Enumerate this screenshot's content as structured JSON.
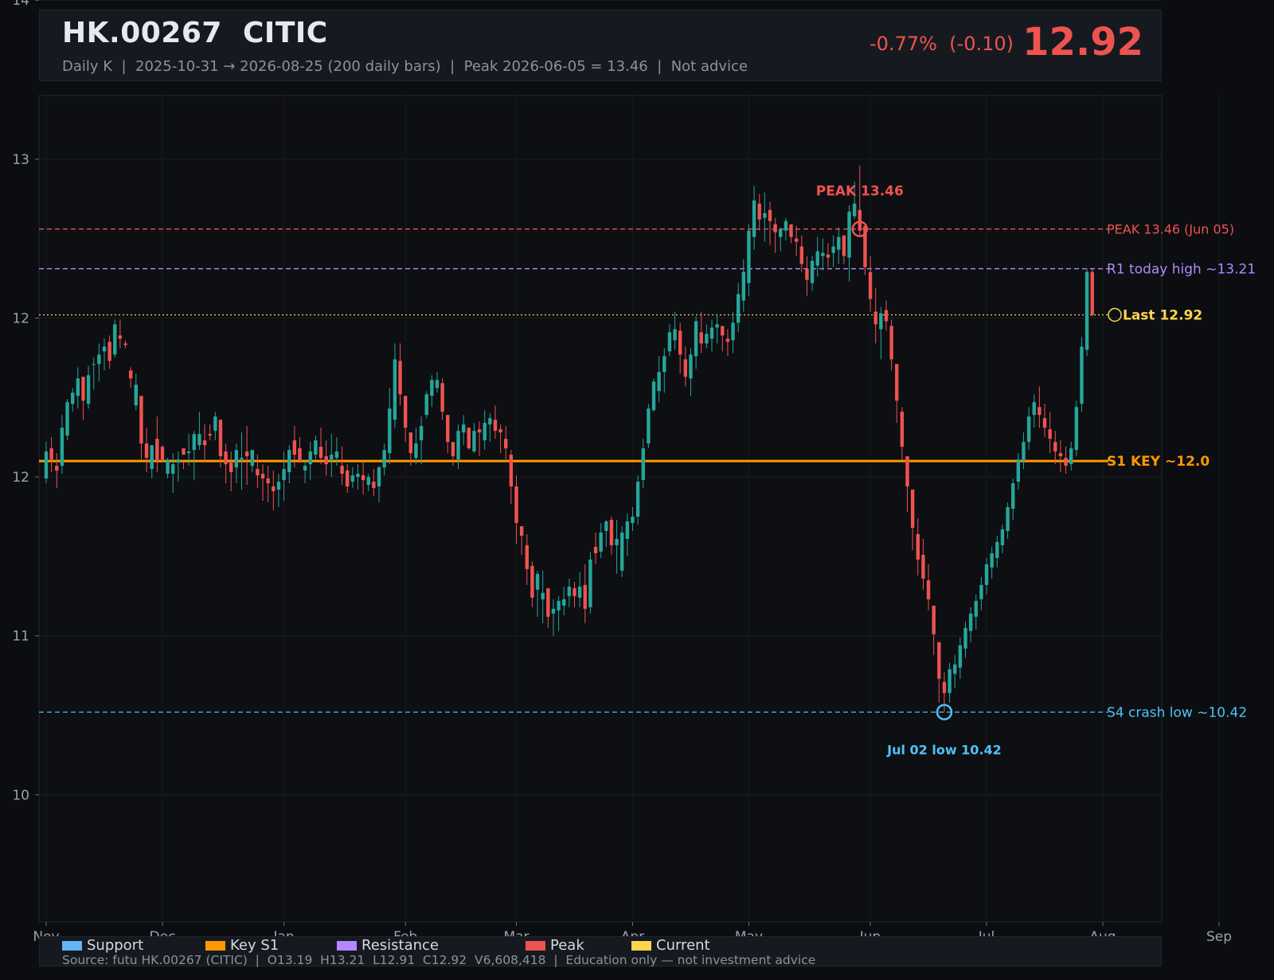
{
  "header": {
    "ticker": "HK.00267  CITIC",
    "subtitle": "Daily K  |  2025-10-31 → 2026-08-25 (200 daily bars)  |  Peak 2026-06-05 = 13.46  |  Not advice",
    "change": "-0.77%  (-0.10)",
    "price": "12.92"
  },
  "chart_data": {
    "type": "candlestick",
    "y_ticks": [
      "10",
      "11",
      "12",
      "12",
      "13",
      "14"
    ],
    "y_tick_values": [
      9.9,
      10.9,
      11.9,
      12.9,
      13.9,
      14.9
    ],
    "x_ticks": [
      "Nov",
      "Dec",
      "Jan",
      "Feb",
      "Mar",
      "Apr",
      "May",
      "Jun",
      "Jul",
      "Aug",
      "Sep"
    ],
    "x_tick_bars": [
      0,
      22,
      45,
      68,
      89,
      111,
      133,
      156,
      178,
      200,
      222
    ],
    "ylim": [
      9.1,
      14.3
    ],
    "grid": true,
    "levels": [
      {
        "name": "PEAK 13.46 (Jun 05)",
        "value": 13.46,
        "kind": "peak",
        "color": "#ef5350",
        "style": "dashed"
      },
      {
        "name": "R1 today high ~13.21",
        "value": 13.21,
        "kind": "resistance",
        "color": "#b388ff",
        "style": "dashed"
      },
      {
        "name": "Last 12.92",
        "value": 12.92,
        "kind": "current",
        "color": "#ffd54f",
        "style": "dotted"
      },
      {
        "name": "S1 KEY ~12.0",
        "value": 12.0,
        "kind": "key",
        "color": "#ff9800",
        "style": "solid"
      },
      {
        "name": "S4 crash low ~10.42",
        "value": 10.42,
        "kind": "support",
        "color": "#4fc3f7",
        "style": "dashed"
      }
    ],
    "annotations": [
      {
        "text": "PEAK 13.46",
        "value": 13.46,
        "color": "#ef5350"
      },
      {
        "text": "Jul 02 low 10.42",
        "value": 10.42,
        "color": "#4fc3f7"
      }
    ],
    "ohlc": [
      [
        11.89,
        12.12,
        11.86,
        12.06
      ],
      [
        12.08,
        12.15,
        11.93,
        12.01
      ],
      [
        11.97,
        12.05,
        11.83,
        11.94
      ],
      [
        11.97,
        12.29,
        11.92,
        12.21
      ],
      [
        12.16,
        12.39,
        12.13,
        12.37
      ],
      [
        12.36,
        12.46,
        12.31,
        12.43
      ],
      [
        12.41,
        12.59,
        12.33,
        12.52
      ],
      [
        12.53,
        12.52,
        12.26,
        12.38
      ],
      [
        12.36,
        12.6,
        12.33,
        12.54
      ],
      [
        12.61,
        12.65,
        12.45,
        12.61
      ],
      [
        12.61,
        12.74,
        12.5,
        12.67
      ],
      [
        12.69,
        12.77,
        12.57,
        12.72
      ],
      [
        12.75,
        12.79,
        12.58,
        12.63
      ],
      [
        12.67,
        12.89,
        12.65,
        12.86
      ],
      [
        12.79,
        12.89,
        12.71,
        12.77
      ],
      [
        12.74,
        12.76,
        12.71,
        12.73
      ],
      [
        12.57,
        12.59,
        12.46,
        12.52
      ],
      [
        12.35,
        12.55,
        12.32,
        12.48
      ],
      [
        12.41,
        12.29,
        12.01,
        12.11
      ],
      [
        12.11,
        12.21,
        11.93,
        12.02
      ],
      [
        11.95,
        12.09,
        11.89,
        12.1
      ],
      [
        12.14,
        12.28,
        11.93,
        12.0
      ],
      [
        12.09,
        12.1,
        11.99,
        12.01
      ],
      [
        11.92,
        12.02,
        11.89,
        12.01
      ],
      [
        11.92,
        12.05,
        11.8,
        11.98
      ],
      [
        11.99,
        12.06,
        11.87,
        12.01
      ],
      [
        12.08,
        12.0,
        11.95,
        12.04
      ],
      [
        12.05,
        12.17,
        11.97,
        12.06
      ],
      [
        12.07,
        12.19,
        11.88,
        12.17
      ],
      [
        12.1,
        12.31,
        12.07,
        12.17
      ],
      [
        12.13,
        12.23,
        11.99,
        12.1
      ],
      [
        12.17,
        12.23,
        12.13,
        12.16
      ],
      [
        12.19,
        12.31,
        12.13,
        12.28
      ],
      [
        12.26,
        12.15,
        11.96,
        12.03
      ],
      [
        12.06,
        12.11,
        11.86,
        11.98
      ],
      [
        11.99,
        12.06,
        11.81,
        11.93
      ],
      [
        11.96,
        12.11,
        11.86,
        12.07
      ],
      [
        12.01,
        12.18,
        11.82,
        12.02
      ],
      [
        12.06,
        12.22,
        11.85,
        12.03
      ],
      [
        11.97,
        12.03,
        11.93,
        12.07
      ],
      [
        11.95,
        12.04,
        11.83,
        11.91
      ],
      [
        11.92,
        11.98,
        11.75,
        11.89
      ],
      [
        11.89,
        11.97,
        11.74,
        11.86
      ],
      [
        11.84,
        11.94,
        11.69,
        11.81
      ],
      [
        11.82,
        11.92,
        11.71,
        11.87
      ],
      [
        11.88,
        12.06,
        11.75,
        11.95
      ],
      [
        11.93,
        12.1,
        11.86,
        12.07
      ],
      [
        12.13,
        12.22,
        11.96,
        12.04
      ],
      [
        12.08,
        12.15,
        11.99,
        12.0
      ],
      [
        11.94,
        12.0,
        11.86,
        11.97
      ],
      [
        11.98,
        12.12,
        11.88,
        12.06
      ],
      [
        12.04,
        12.16,
        12.01,
        12.13
      ],
      [
        12.09,
        12.21,
        11.98,
        12.02
      ],
      [
        12.03,
        12.13,
        11.91,
        11.98
      ],
      [
        12.01,
        12.17,
        11.9,
        12.04
      ],
      [
        12.02,
        12.15,
        11.97,
        12.06
      ],
      [
        11.97,
        12.09,
        11.85,
        11.92
      ],
      [
        11.94,
        11.98,
        11.8,
        11.84
      ],
      [
        11.87,
        11.96,
        11.83,
        11.91
      ],
      [
        11.9,
        11.98,
        11.82,
        11.92
      ],
      [
        11.91,
        12.0,
        11.79,
        11.88
      ],
      [
        11.85,
        11.92,
        11.81,
        11.9
      ],
      [
        11.87,
        11.95,
        11.78,
        11.83
      ],
      [
        11.84,
        11.97,
        11.74,
        11.96
      ],
      [
        11.96,
        12.11,
        11.91,
        12.07
      ],
      [
        12.05,
        12.46,
        11.98,
        12.33
      ],
      [
        12.26,
        12.74,
        12.21,
        12.64
      ],
      [
        12.63,
        12.74,
        12.35,
        12.42
      ],
      [
        12.41,
        12.34,
        12.12,
        12.21
      ],
      [
        12.18,
        12.11,
        11.97,
        12.05
      ],
      [
        12.02,
        12.21,
        11.98,
        12.11
      ],
      [
        12.13,
        12.28,
        11.98,
        12.22
      ],
      [
        12.29,
        12.44,
        12.27,
        12.42
      ],
      [
        12.41,
        12.54,
        12.34,
        12.51
      ],
      [
        12.46,
        12.56,
        12.43,
        12.51
      ],
      [
        12.49,
        12.52,
        12.26,
        12.31
      ],
      [
        12.29,
        12.28,
        12.05,
        12.12
      ],
      [
        12.12,
        12.09,
        11.97,
        12.03
      ],
      [
        12.01,
        12.23,
        11.95,
        12.19
      ],
      [
        12.18,
        12.29,
        12.1,
        12.23
      ],
      [
        12.21,
        12.16,
        12.07,
        12.08
      ],
      [
        12.06,
        12.24,
        12.05,
        12.19
      ],
      [
        12.2,
        12.25,
        12.03,
        12.18
      ],
      [
        12.13,
        12.32,
        12.07,
        12.24
      ],
      [
        12.23,
        12.3,
        12.12,
        12.27
      ],
      [
        12.26,
        12.35,
        12.14,
        12.19
      ],
      [
        12.2,
        12.23,
        12.05,
        12.18
      ],
      [
        12.14,
        12.22,
        12.01,
        12.08
      ],
      [
        12.04,
        12.07,
        11.73,
        11.84
      ],
      [
        11.84,
        11.91,
        11.48,
        11.61
      ],
      [
        11.59,
        11.58,
        11.41,
        11.53
      ],
      [
        11.47,
        11.54,
        11.22,
        11.32
      ],
      [
        11.34,
        11.37,
        11.08,
        11.14
      ],
      [
        11.19,
        11.31,
        11.02,
        11.29
      ],
      [
        11.13,
        11.31,
        10.98,
        11.17
      ],
      [
        11.2,
        11.13,
        10.95,
        11.02
      ],
      [
        11.04,
        11.13,
        10.9,
        11.07
      ],
      [
        11.06,
        11.15,
        10.93,
        11.12
      ],
      [
        11.09,
        11.21,
        11.03,
        11.13
      ],
      [
        11.15,
        11.26,
        11.08,
        11.21
      ],
      [
        11.2,
        11.24,
        11.08,
        11.15
      ],
      [
        11.14,
        11.3,
        11.08,
        11.21
      ],
      [
        11.22,
        11.35,
        10.98,
        11.07
      ],
      [
        11.08,
        11.43,
        11.04,
        11.38
      ],
      [
        11.46,
        11.55,
        11.35,
        11.42
      ],
      [
        11.43,
        11.61,
        11.39,
        11.55
      ],
      [
        11.56,
        11.63,
        11.46,
        11.62
      ],
      [
        11.63,
        11.65,
        11.41,
        11.47
      ],
      [
        11.47,
        11.63,
        11.29,
        11.51
      ],
      [
        11.31,
        11.59,
        11.27,
        11.55
      ],
      [
        11.51,
        11.67,
        11.4,
        11.62
      ],
      [
        11.61,
        11.71,
        11.56,
        11.65
      ],
      [
        11.65,
        11.91,
        11.6,
        11.87
      ],
      [
        11.88,
        12.14,
        11.83,
        12.08
      ],
      [
        12.11,
        12.36,
        12.08,
        12.33
      ],
      [
        12.32,
        12.52,
        12.31,
        12.5
      ],
      [
        12.44,
        12.66,
        12.37,
        12.56
      ],
      [
        12.56,
        12.71,
        12.43,
        12.66
      ],
      [
        12.69,
        12.86,
        12.66,
        12.81
      ],
      [
        12.76,
        12.94,
        12.7,
        12.83
      ],
      [
        12.82,
        12.87,
        12.55,
        12.67
      ],
      [
        12.64,
        12.72,
        12.47,
        12.53
      ],
      [
        12.52,
        12.71,
        12.41,
        12.67
      ],
      [
        12.66,
        12.91,
        12.58,
        12.88
      ],
      [
        12.81,
        12.94,
        12.68,
        12.74
      ],
      [
        12.74,
        12.86,
        12.71,
        12.8
      ],
      [
        12.77,
        12.89,
        12.69,
        12.84
      ],
      [
        12.84,
        12.92,
        12.74,
        12.86
      ],
      [
        12.85,
        12.82,
        12.69,
        12.79
      ],
      [
        12.77,
        12.83,
        12.66,
        12.75
      ],
      [
        12.76,
        12.94,
        12.68,
        12.87
      ],
      [
        12.87,
        13.12,
        12.81,
        13.05
      ],
      [
        13.01,
        13.27,
        12.94,
        13.19
      ],
      [
        13.12,
        13.49,
        13.04,
        13.45
      ],
      [
        13.41,
        13.73,
        13.33,
        13.64
      ],
      [
        13.62,
        13.68,
        13.45,
        13.52
      ],
      [
        13.53,
        13.69,
        13.38,
        13.56
      ],
      [
        13.58,
        13.63,
        13.36,
        13.51
      ],
      [
        13.49,
        13.53,
        13.31,
        13.44
      ],
      [
        13.41,
        13.47,
        13.32,
        13.46
      ],
      [
        13.45,
        13.53,
        13.39,
        13.51
      ],
      [
        13.49,
        13.46,
        13.37,
        13.41
      ],
      [
        13.4,
        13.48,
        13.29,
        13.38
      ],
      [
        13.35,
        13.42,
        13.19,
        13.24
      ],
      [
        13.21,
        13.29,
        13.04,
        13.14
      ],
      [
        13.12,
        13.29,
        13.07,
        13.26
      ],
      [
        13.23,
        13.41,
        13.16,
        13.32
      ],
      [
        13.29,
        13.4,
        13.2,
        13.31
      ],
      [
        13.3,
        13.37,
        13.22,
        13.28
      ],
      [
        13.31,
        13.42,
        13.22,
        13.35
      ],
      [
        13.33,
        13.47,
        13.24,
        13.41
      ],
      [
        13.42,
        13.38,
        13.24,
        13.29
      ],
      [
        13.28,
        13.61,
        13.13,
        13.57
      ],
      [
        13.54,
        13.76,
        13.52,
        13.62
      ],
      [
        13.58,
        13.86,
        13.41,
        13.45
      ],
      [
        13.48,
        13.37,
        13.17,
        13.22
      ],
      [
        13.19,
        13.29,
        12.94,
        13.02
      ],
      [
        12.94,
        13.09,
        12.74,
        12.86
      ],
      [
        12.83,
        12.97,
        12.64,
        12.93
      ],
      [
        12.95,
        13.01,
        12.82,
        12.88
      ],
      [
        12.85,
        12.89,
        12.57,
        12.64
      ],
      [
        12.61,
        12.58,
        12.24,
        12.38
      ],
      [
        12.31,
        12.34,
        12.0,
        12.09
      ],
      [
        12.03,
        11.96,
        11.68,
        11.84
      ],
      [
        11.82,
        11.77,
        11.44,
        11.58
      ],
      [
        11.54,
        11.64,
        11.28,
        11.38
      ],
      [
        11.41,
        11.51,
        11.19,
        11.26
      ],
      [
        11.25,
        11.35,
        11.06,
        11.13
      ],
      [
        11.09,
        11.04,
        10.78,
        10.91
      ],
      [
        10.86,
        10.75,
        10.48,
        10.63
      ],
      [
        10.61,
        10.67,
        10.42,
        10.54
      ],
      [
        10.54,
        10.73,
        10.48,
        10.69
      ],
      [
        10.66,
        10.78,
        10.57,
        10.72
      ],
      [
        10.7,
        10.89,
        10.63,
        10.84
      ],
      [
        10.82,
        10.99,
        10.76,
        10.95
      ],
      [
        10.93,
        11.08,
        10.86,
        11.04
      ],
      [
        11.02,
        11.16,
        10.94,
        11.12
      ],
      [
        11.13,
        11.27,
        11.06,
        11.22
      ],
      [
        11.22,
        11.39,
        11.16,
        11.35
      ],
      [
        11.33,
        11.46,
        11.26,
        11.42
      ],
      [
        11.39,
        11.53,
        11.33,
        11.49
      ],
      [
        11.47,
        11.6,
        11.42,
        11.57
      ],
      [
        11.56,
        11.74,
        11.51,
        11.71
      ],
      [
        11.7,
        11.89,
        11.63,
        11.86
      ],
      [
        11.87,
        12.05,
        11.82,
        12.01
      ],
      [
        12.0,
        12.18,
        11.95,
        12.12
      ],
      [
        12.12,
        12.34,
        12.07,
        12.28
      ],
      [
        12.29,
        12.42,
        12.21,
        12.37
      ],
      [
        12.34,
        12.47,
        12.21,
        12.29
      ],
      [
        12.27,
        12.36,
        12.15,
        12.21
      ],
      [
        12.2,
        12.31,
        12.05,
        12.14
      ],
      [
        12.12,
        12.19,
        11.98,
        12.06
      ],
      [
        12.05,
        12.13,
        11.93,
        12.03
      ],
      [
        12.02,
        12.09,
        11.92,
        11.97
      ],
      [
        11.98,
        12.12,
        11.94,
        12.08
      ],
      [
        12.07,
        12.38,
        12.03,
        12.34
      ],
      [
        12.36,
        12.78,
        12.31,
        12.72
      ],
      [
        12.7,
        13.21,
        12.66,
        13.19
      ],
      [
        13.19,
        13.21,
        12.91,
        12.92
      ]
    ]
  },
  "legend": [
    {
      "label": "Support",
      "color": "#64b5f6"
    },
    {
      "label": "Key S1",
      "color": "#ff9800"
    },
    {
      "label": "Resistance",
      "color": "#b388ff"
    },
    {
      "label": "Peak",
      "color": "#ef5350"
    },
    {
      "label": "Current",
      "color": "#ffd54f"
    }
  ],
  "footer": {
    "source": "Source: futu HK.00267 (CITIC)  |  O13.19  H13.21  L12.91  C12.92  V6,608,418  |  Education only — not investment advice"
  }
}
